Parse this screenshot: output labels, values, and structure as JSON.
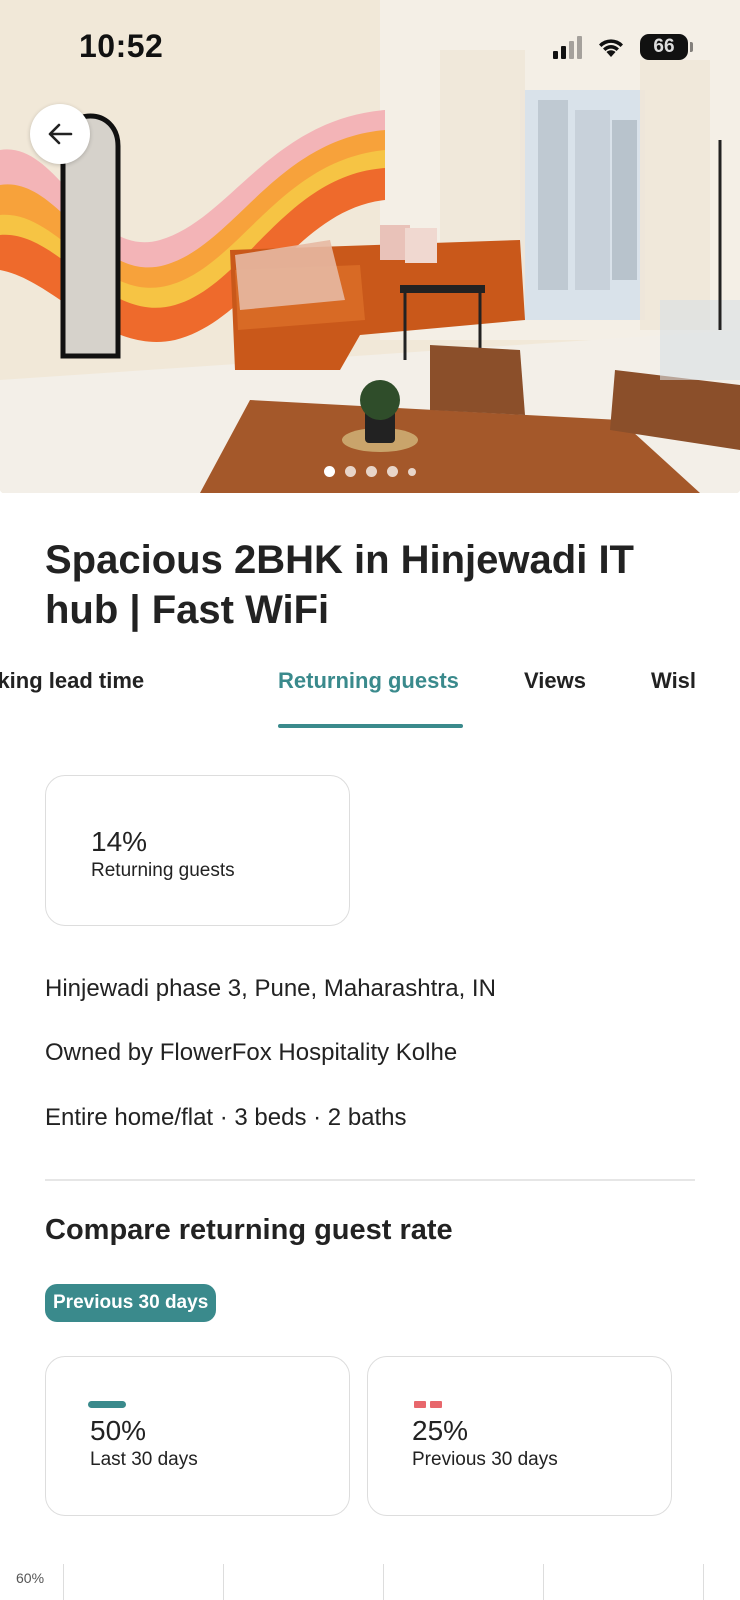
{
  "status_bar": {
    "time": "10:52",
    "battery": "66"
  },
  "hero": {
    "photo_count": 5,
    "active_photo": 1
  },
  "listing": {
    "title": "Spacious 2BHK in Hinjewadi IT hub | Fast WiFi",
    "location": "Hinjewadi phase 3, Pune, Maharashtra, IN",
    "owner": "Owned by FlowerFox Hospitality Kolhe",
    "summary": "Entire home/flat · 3 beds · 2 baths"
  },
  "tabs": [
    {
      "label": "oking lead time",
      "active": false
    },
    {
      "label": "Returning guests",
      "active": true
    },
    {
      "label": "Views",
      "active": false
    },
    {
      "label": "Wisl",
      "active": false
    }
  ],
  "metric": {
    "value": "14%",
    "label": "Returning guests"
  },
  "compare": {
    "title": "Compare returning guest rate",
    "period_pill": "Previous 30 days",
    "cards": [
      {
        "value": "50%",
        "label": "Last 30 days",
        "legend": "solid",
        "color": "#3a8a8c"
      },
      {
        "value": "25%",
        "label": "Previous 30 days",
        "legend": "dashed",
        "color": "#e8676c"
      }
    ]
  },
  "chart": {
    "y_tick_top": "60%"
  },
  "colors": {
    "accent": "#3a8a8c",
    "previous": "#e8676c",
    "text": "#222222",
    "border": "#dddddd"
  }
}
